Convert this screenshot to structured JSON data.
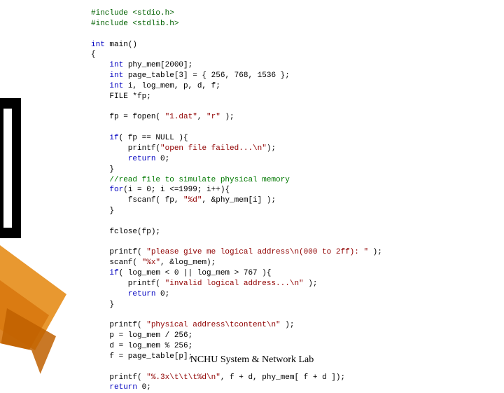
{
  "footer": "NCHU System & Network Lab",
  "lines": [
    {
      "segs": [
        {
          "cls": "c-pp",
          "t": "#include <stdio.h>"
        }
      ]
    },
    {
      "segs": [
        {
          "cls": "c-pp",
          "t": "#include <stdlib.h>"
        }
      ]
    },
    {
      "segs": [
        {
          "cls": "",
          "t": ""
        }
      ]
    },
    {
      "segs": [
        {
          "cls": "c-kw",
          "t": "int"
        },
        {
          "cls": "",
          "t": " main()"
        }
      ]
    },
    {
      "segs": [
        {
          "cls": "",
          "t": "{"
        }
      ]
    },
    {
      "segs": [
        {
          "cls": "",
          "t": "    "
        },
        {
          "cls": "c-kw",
          "t": "int"
        },
        {
          "cls": "",
          "t": " phy_mem[2000];"
        }
      ]
    },
    {
      "segs": [
        {
          "cls": "",
          "t": "    "
        },
        {
          "cls": "c-kw",
          "t": "int"
        },
        {
          "cls": "",
          "t": " page_table[3] = { 256, 768, 1536 };"
        }
      ]
    },
    {
      "segs": [
        {
          "cls": "",
          "t": "    "
        },
        {
          "cls": "c-kw",
          "t": "int"
        },
        {
          "cls": "",
          "t": " i, log_mem, p, d, f;"
        }
      ]
    },
    {
      "segs": [
        {
          "cls": "",
          "t": "    FILE *fp;"
        }
      ]
    },
    {
      "segs": [
        {
          "cls": "",
          "t": ""
        }
      ]
    },
    {
      "segs": [
        {
          "cls": "",
          "t": "    fp = fopen( "
        },
        {
          "cls": "c-str",
          "t": "\"1.dat\""
        },
        {
          "cls": "",
          "t": ", "
        },
        {
          "cls": "c-str",
          "t": "\"r\""
        },
        {
          "cls": "",
          "t": " );"
        }
      ]
    },
    {
      "segs": [
        {
          "cls": "",
          "t": ""
        }
      ]
    },
    {
      "segs": [
        {
          "cls": "",
          "t": "    "
        },
        {
          "cls": "c-kw",
          "t": "if"
        },
        {
          "cls": "",
          "t": "( fp == NULL ){"
        }
      ]
    },
    {
      "segs": [
        {
          "cls": "",
          "t": "        printf("
        },
        {
          "cls": "c-str",
          "t": "\"open file failed...\\n\""
        },
        {
          "cls": "",
          "t": ");"
        }
      ]
    },
    {
      "segs": [
        {
          "cls": "",
          "t": "        "
        },
        {
          "cls": "c-kw",
          "t": "return"
        },
        {
          "cls": "",
          "t": " 0;"
        }
      ]
    },
    {
      "segs": [
        {
          "cls": "",
          "t": "    }"
        }
      ]
    },
    {
      "segs": [
        {
          "cls": "",
          "t": "    "
        },
        {
          "cls": "c-cm",
          "t": "//read file to simulate physical memory"
        }
      ]
    },
    {
      "segs": [
        {
          "cls": "",
          "t": "    "
        },
        {
          "cls": "c-kw",
          "t": "for"
        },
        {
          "cls": "",
          "t": "(i = 0; i <=1999; i++){"
        }
      ]
    },
    {
      "segs": [
        {
          "cls": "",
          "t": "        fscanf( fp, "
        },
        {
          "cls": "c-str",
          "t": "\"%d\""
        },
        {
          "cls": "",
          "t": ", &phy_mem[i] );"
        }
      ]
    },
    {
      "segs": [
        {
          "cls": "",
          "t": "    }"
        }
      ]
    },
    {
      "segs": [
        {
          "cls": "",
          "t": ""
        }
      ]
    },
    {
      "segs": [
        {
          "cls": "",
          "t": "    fclose(fp);"
        }
      ]
    },
    {
      "segs": [
        {
          "cls": "",
          "t": ""
        }
      ]
    },
    {
      "segs": [
        {
          "cls": "",
          "t": "    printf( "
        },
        {
          "cls": "c-str",
          "t": "\"please give me logical address\\n(000 to 2ff): \""
        },
        {
          "cls": "",
          "t": " );"
        }
      ]
    },
    {
      "segs": [
        {
          "cls": "",
          "t": "    scanf( "
        },
        {
          "cls": "c-str",
          "t": "\"%x\""
        },
        {
          "cls": "",
          "t": ", &log_mem);"
        }
      ]
    },
    {
      "segs": [
        {
          "cls": "",
          "t": "    "
        },
        {
          "cls": "c-kw",
          "t": "if"
        },
        {
          "cls": "",
          "t": "( log_mem < 0 || log_mem > 767 ){"
        }
      ]
    },
    {
      "segs": [
        {
          "cls": "",
          "t": "        printf( "
        },
        {
          "cls": "c-str",
          "t": "\"invalid logical address...\\n\""
        },
        {
          "cls": "",
          "t": " );"
        }
      ]
    },
    {
      "segs": [
        {
          "cls": "",
          "t": "        "
        },
        {
          "cls": "c-kw",
          "t": "return"
        },
        {
          "cls": "",
          "t": " 0;"
        }
      ]
    },
    {
      "segs": [
        {
          "cls": "",
          "t": "    }"
        }
      ]
    },
    {
      "segs": [
        {
          "cls": "",
          "t": ""
        }
      ]
    },
    {
      "segs": [
        {
          "cls": "",
          "t": "    printf( "
        },
        {
          "cls": "c-str",
          "t": "\"physical address\\tcontent\\n\""
        },
        {
          "cls": "",
          "t": " );"
        }
      ]
    },
    {
      "segs": [
        {
          "cls": "",
          "t": "    p = log_mem / 256;"
        }
      ]
    },
    {
      "segs": [
        {
          "cls": "",
          "t": "    d = log_mem % 256;"
        }
      ]
    },
    {
      "segs": [
        {
          "cls": "",
          "t": "    f = page_table[p];"
        }
      ]
    },
    {
      "segs": [
        {
          "cls": "",
          "t": ""
        }
      ]
    },
    {
      "segs": [
        {
          "cls": "",
          "t": "    printf( "
        },
        {
          "cls": "c-str",
          "t": "\"%.3x\\t\\t\\t%d\\n\""
        },
        {
          "cls": "",
          "t": ", f + d, phy_mem[ f + d ]);"
        }
      ]
    },
    {
      "segs": [
        {
          "cls": "",
          "t": "    "
        },
        {
          "cls": "c-kw",
          "t": "return"
        },
        {
          "cls": "",
          "t": " 0;"
        }
      ]
    }
  ]
}
